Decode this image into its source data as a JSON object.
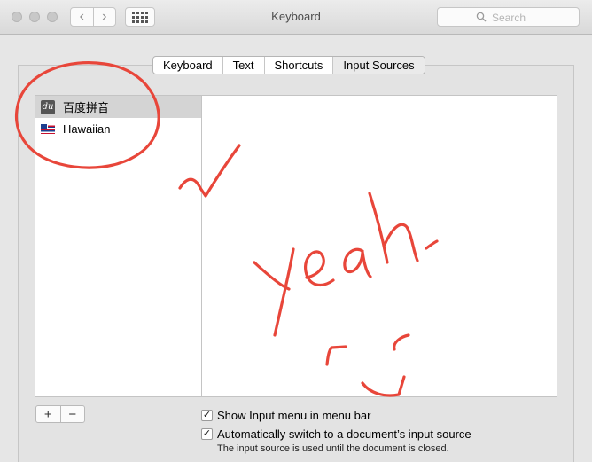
{
  "window": {
    "title": "Keyboard"
  },
  "toolbar": {
    "back_glyph": "‹",
    "forward_glyph": "›",
    "search_placeholder": "Search"
  },
  "tabs": [
    {
      "label": "Keyboard",
      "active": false
    },
    {
      "label": "Text",
      "active": false
    },
    {
      "label": "Shortcuts",
      "active": false
    },
    {
      "label": "Input Sources",
      "active": true
    }
  ],
  "input_sources": [
    {
      "label": "百度拼音",
      "icon": "baidu-du-icon",
      "icon_text": "du",
      "selected": true
    },
    {
      "label": "Hawaiian",
      "icon": "hawaiian-flag-icon",
      "selected": false
    }
  ],
  "list_controls": {
    "add_label": "+",
    "remove_label": "−"
  },
  "options": {
    "show_input_menu": {
      "label": "Show Input menu in menu bar",
      "checked": true,
      "mark": "✓"
    },
    "auto_switch": {
      "label": "Automatically switch to a document’s input source",
      "checked": true,
      "mark": "✓"
    },
    "note": "The input source is used until the document is closed."
  },
  "annotation": {
    "color": "#e8463a",
    "content": "red hand-drawn circle, checkmark, the word yeah and a smiley"
  }
}
